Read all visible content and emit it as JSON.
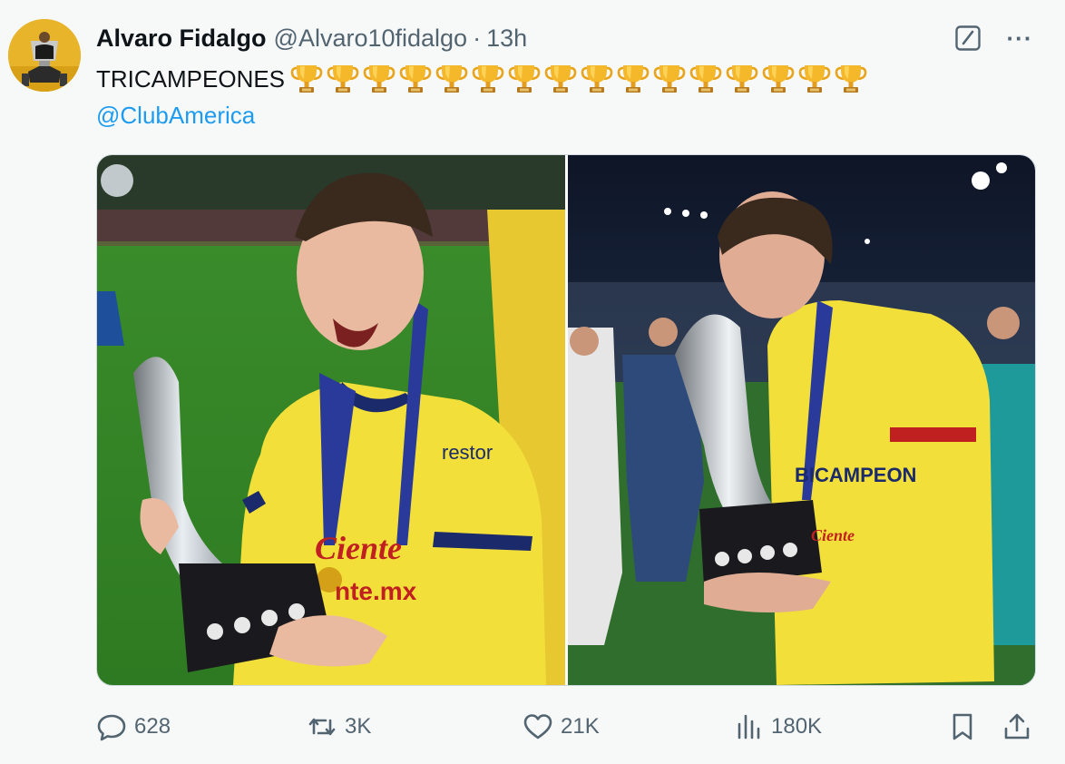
{
  "author": {
    "display_name": "Alvaro Fidalgo",
    "handle": "@Alvaro10fidalgo",
    "separator": "·",
    "time": "13h",
    "avatar_icon": "avatar-photo"
  },
  "header_actions": {
    "grok_icon": "grok-icon",
    "more_label": "···"
  },
  "tweet": {
    "text": "TRICAMPEONES",
    "trophy_emoji": "🏆",
    "trophy_count": 16,
    "mention": "@ClubAmerica"
  },
  "media": {
    "count": 2,
    "photos": [
      "left-photo",
      "right-photo"
    ]
  },
  "actions": {
    "replies": "628",
    "reposts": "3K",
    "likes": "21K",
    "views": "180K",
    "bookmark_icon": "bookmark-icon",
    "share_icon": "share-icon"
  },
  "colors": {
    "accent": "#1d9bf0",
    "secondary_text": "#536471",
    "primary_text": "#0f1419",
    "background": "#f7f9f9"
  }
}
